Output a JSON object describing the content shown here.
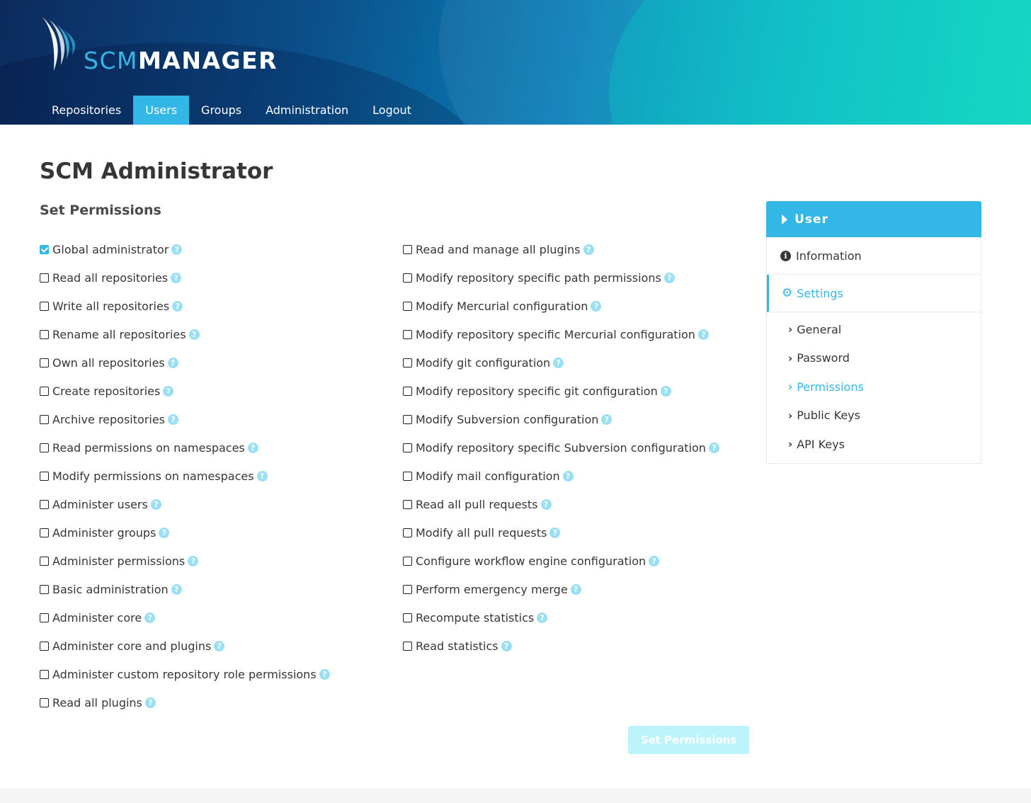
{
  "brand": {
    "scm": "SCM",
    "manager": "MANAGER",
    "accent": "#33b7e6"
  },
  "nav": {
    "items": [
      {
        "label": "Repositories",
        "active": false
      },
      {
        "label": "Users",
        "active": true
      },
      {
        "label": "Groups",
        "active": false
      },
      {
        "label": "Administration",
        "active": false
      },
      {
        "label": "Logout",
        "active": false
      }
    ]
  },
  "page": {
    "title": "SCM Administrator",
    "subtitle": "Set Permissions",
    "submit_label": "Set Permissions"
  },
  "permissions": {
    "left": [
      {
        "label": "Global administrator",
        "checked": true
      },
      {
        "label": "Read all repositories",
        "checked": false
      },
      {
        "label": "Write all repositories",
        "checked": false
      },
      {
        "label": "Rename all repositories",
        "checked": false
      },
      {
        "label": "Own all repositories",
        "checked": false
      },
      {
        "label": "Create repositories",
        "checked": false
      },
      {
        "label": "Archive repositories",
        "checked": false
      },
      {
        "label": "Read permissions on namespaces",
        "checked": false
      },
      {
        "label": "Modify permissions on namespaces",
        "checked": false
      },
      {
        "label": "Administer users",
        "checked": false
      },
      {
        "label": "Administer groups",
        "checked": false
      },
      {
        "label": "Administer permissions",
        "checked": false
      },
      {
        "label": "Basic administration",
        "checked": false
      },
      {
        "label": "Administer core",
        "checked": false
      },
      {
        "label": "Administer core and plugins",
        "checked": false
      },
      {
        "label": "Administer custom repository role permissions",
        "checked": false
      },
      {
        "label": "Read all plugins",
        "checked": false
      }
    ],
    "right": [
      {
        "label": "Read and manage all plugins",
        "checked": false
      },
      {
        "label": "Modify repository specific path permissions",
        "checked": false
      },
      {
        "label": "Modify Mercurial configuration",
        "checked": false
      },
      {
        "label": "Modify repository specific Mercurial configuration",
        "checked": false
      },
      {
        "label": "Modify git configuration",
        "checked": false
      },
      {
        "label": "Modify repository specific git configuration",
        "checked": false
      },
      {
        "label": "Modify Subversion configuration",
        "checked": false
      },
      {
        "label": "Modify repository specific Subversion configuration",
        "checked": false
      },
      {
        "label": "Modify mail configuration",
        "checked": false
      },
      {
        "label": "Read all pull requests",
        "checked": false
      },
      {
        "label": "Modify all pull requests",
        "checked": false
      },
      {
        "label": "Configure workflow engine configuration",
        "checked": false
      },
      {
        "label": "Perform emergency merge",
        "checked": false
      },
      {
        "label": "Recompute statistics",
        "checked": false
      },
      {
        "label": "Read statistics",
        "checked": false
      }
    ]
  },
  "sidebar": {
    "header": "User",
    "information": "Information",
    "settings": "Settings",
    "sub_items": [
      {
        "label": "General",
        "active": false
      },
      {
        "label": "Password",
        "active": false
      },
      {
        "label": "Permissions",
        "active": true
      },
      {
        "label": "Public Keys",
        "active": false
      },
      {
        "label": "API Keys",
        "active": false
      }
    ]
  }
}
